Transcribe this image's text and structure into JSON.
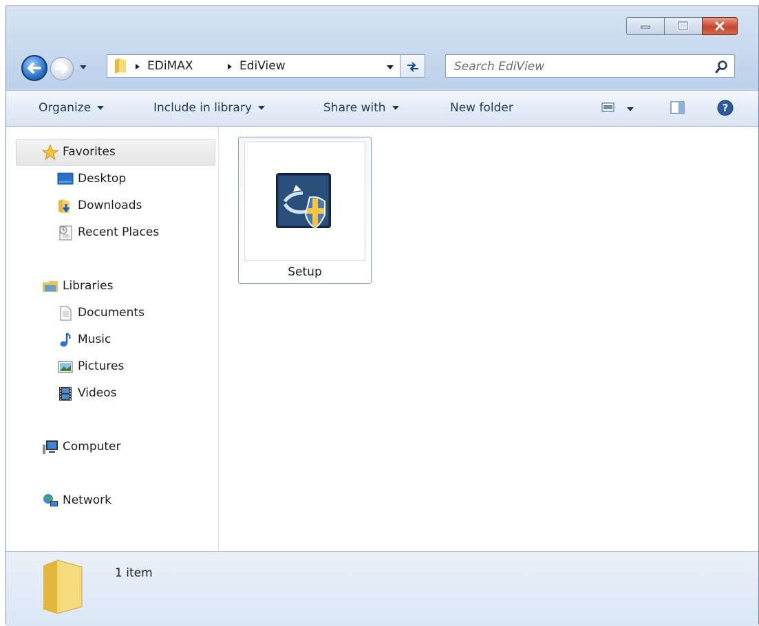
{
  "address_bar": {
    "breadcrumbs": [
      "EDiMAX",
      "EdiView"
    ]
  },
  "search": {
    "placeholder": "Search EdiView"
  },
  "toolbar": {
    "organize": "Organize",
    "include_in_library": "Include in library",
    "share_with": "Share with",
    "new_folder": "New folder"
  },
  "nav_pane": {
    "favorites": {
      "label": "Favorites",
      "items": [
        {
          "label": "Desktop",
          "icon": "desktop-icon"
        },
        {
          "label": "Downloads",
          "icon": "downloads-icon"
        },
        {
          "label": "Recent Places",
          "icon": "recent-places-icon"
        }
      ]
    },
    "libraries": {
      "label": "Libraries",
      "items": [
        {
          "label": "Documents",
          "icon": "documents-icon"
        },
        {
          "label": "Music",
          "icon": "music-icon"
        },
        {
          "label": "Pictures",
          "icon": "pictures-icon"
        },
        {
          "label": "Videos",
          "icon": "videos-icon"
        }
      ]
    },
    "computer": {
      "label": "Computer"
    },
    "network": {
      "label": "Network"
    }
  },
  "files": [
    {
      "name": "Setup",
      "icon": "setup-installer-icon"
    }
  ],
  "status_bar": {
    "count": "1 item"
  },
  "colors": {
    "frame": "#c9daee",
    "toolbar_text": "#1e395b",
    "selection_border": "#7da2ce",
    "close_button": "#c8462d"
  }
}
